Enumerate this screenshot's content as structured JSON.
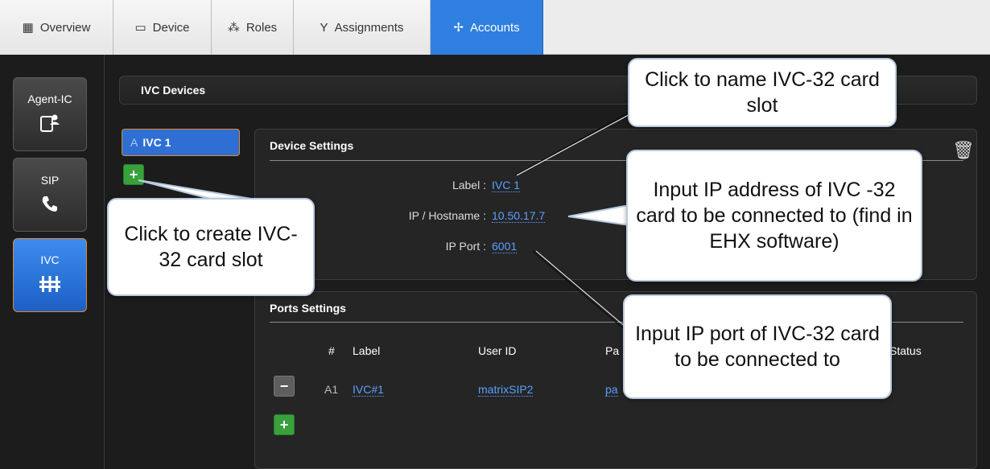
{
  "tabs": [
    {
      "label": "Overview",
      "icon": "overview-icon",
      "active": false
    },
    {
      "label": "Device",
      "icon": "device-icon",
      "active": false
    },
    {
      "label": "Roles",
      "icon": "roles-icon",
      "active": false
    },
    {
      "label": "Assignments",
      "icon": "assignments-icon",
      "active": false
    },
    {
      "label": "Accounts",
      "icon": "accounts-icon",
      "active": true
    }
  ],
  "sidebar": {
    "items": [
      {
        "label": "Agent-IC",
        "icon": "agent-ic-icon",
        "active": false
      },
      {
        "label": "SIP",
        "icon": "phone-icon",
        "active": false
      },
      {
        "label": "IVC",
        "icon": "ivc-icon",
        "active": true
      }
    ]
  },
  "main": {
    "section_title": "IVC Devices",
    "device_list": [
      {
        "prefix": "A",
        "label": "IVC 1",
        "selected": true
      }
    ],
    "device_settings": {
      "title": "Device Settings",
      "label_key": "Label :",
      "label_val": "IVC 1",
      "ip_key": "IP / Hostname :",
      "ip_val": "10.50.17.7",
      "port_key": "IP Port :",
      "port_val": "6001"
    },
    "ports_settings": {
      "title": "Ports Settings",
      "headers": [
        "#",
        "Label",
        "User ID",
        "Pa",
        "Status"
      ],
      "rows": [
        {
          "num": "A1",
          "label": "IVC#1",
          "user_id": "matrixSIP2",
          "password": "pa"
        }
      ]
    }
  },
  "callouts": {
    "name_slot": "Click to name IVC-32 card slot",
    "create_slot": "Click to create IVC-32 card slot",
    "ip_address": "Input IP address of IVC -32 card to be connected to (find in EHX software)",
    "ip_port": "Input IP port of IVC-32 card to be connected to"
  },
  "colors": {
    "accent": "#2f7fe0",
    "add_button": "#38a13c",
    "link": "#5aa0ff",
    "selected_border": "#e08a2c"
  }
}
